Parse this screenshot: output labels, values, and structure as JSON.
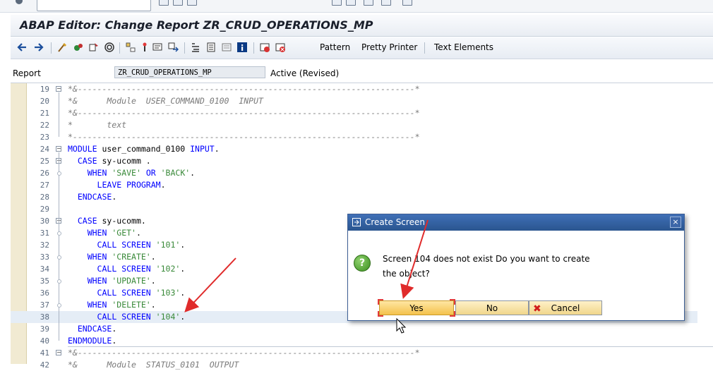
{
  "window": {
    "title": "ABAP Editor: Change Report ZR_CRUD_OPERATIONS_MP"
  },
  "toolbar": {
    "icons": [
      "back-icon",
      "forward-icon",
      "check-syntax-icon",
      "activate-icon",
      "other-object-icon",
      "where-used-icon",
      "display-object-list-icon",
      "set-breakpoint-icon",
      "enhance-icon",
      "navigate-icon",
      "pretty-print-icon",
      "insert-statement-icon",
      "display-list-icon",
      "info-icon",
      "help-icon",
      "cancel-icon"
    ],
    "pattern_label": "Pattern",
    "pretty_printer_label": "Pretty Printer",
    "text_elements_label": "Text Elements"
  },
  "report": {
    "label": "Report",
    "value": "ZR_CRUD_OPERATIONS_MP",
    "status": "Active (Revised)"
  },
  "editor": {
    "lines": [
      {
        "num": "19",
        "text": "*&---------------------------------------------------------------------*"
      },
      {
        "num": "20",
        "text": "*&      Module  USER_COMMAND_0100  INPUT"
      },
      {
        "num": "21",
        "text": "*&---------------------------------------------------------------------*"
      },
      {
        "num": "22",
        "text": "*       text"
      },
      {
        "num": "23",
        "text": "*----------------------------------------------------------------------*"
      },
      {
        "num": "24",
        "text": "MODULE user_command_0100 INPUT."
      },
      {
        "num": "25",
        "text": "  CASE sy-ucomm ."
      },
      {
        "num": "26",
        "text": "    WHEN 'SAVE' OR 'BACK'."
      },
      {
        "num": "27",
        "text": "      LEAVE PROGRAM."
      },
      {
        "num": "28",
        "text": "  ENDCASE."
      },
      {
        "num": "29",
        "text": ""
      },
      {
        "num": "30",
        "text": "  CASE sy-ucomm."
      },
      {
        "num": "31",
        "text": "    WHEN 'GET'."
      },
      {
        "num": "32",
        "text": "      CALL SCREEN '101'."
      },
      {
        "num": "33",
        "text": "    WHEN 'CREATE'."
      },
      {
        "num": "34",
        "text": "      CALL SCREEN '102'."
      },
      {
        "num": "35",
        "text": "    WHEN 'UPDATE'."
      },
      {
        "num": "36",
        "text": "      CALL SCREEN '103'."
      },
      {
        "num": "37",
        "text": "    WHEN 'DELETE'."
      },
      {
        "num": "38",
        "text": "      CALL SCREEN '104'."
      },
      {
        "num": "39",
        "text": "  ENDCASE."
      },
      {
        "num": "40",
        "text": "ENDMODULE."
      },
      {
        "num": "41",
        "text": "*&---------------------------------------------------------------------*"
      },
      {
        "num": "42",
        "text": "*&      Module  STATUS_0101  OUTPUT"
      }
    ],
    "highlighted_line": "38"
  },
  "dialog": {
    "title": "Create Screen",
    "close_glyph": "×",
    "icon": "question-icon",
    "message_line1": "Screen 104 does not exist Do you want to create",
    "message_line2": "the object?",
    "yes_label": "Yes",
    "no_label": "No",
    "cancel_label": "Cancel"
  },
  "colors": {
    "keyword": "#0000ff",
    "string": "#3a8a3a",
    "comment": "#7a7a7a",
    "annotation_arrow": "#e02b2b",
    "dialog_title": "#2f5c9b"
  }
}
